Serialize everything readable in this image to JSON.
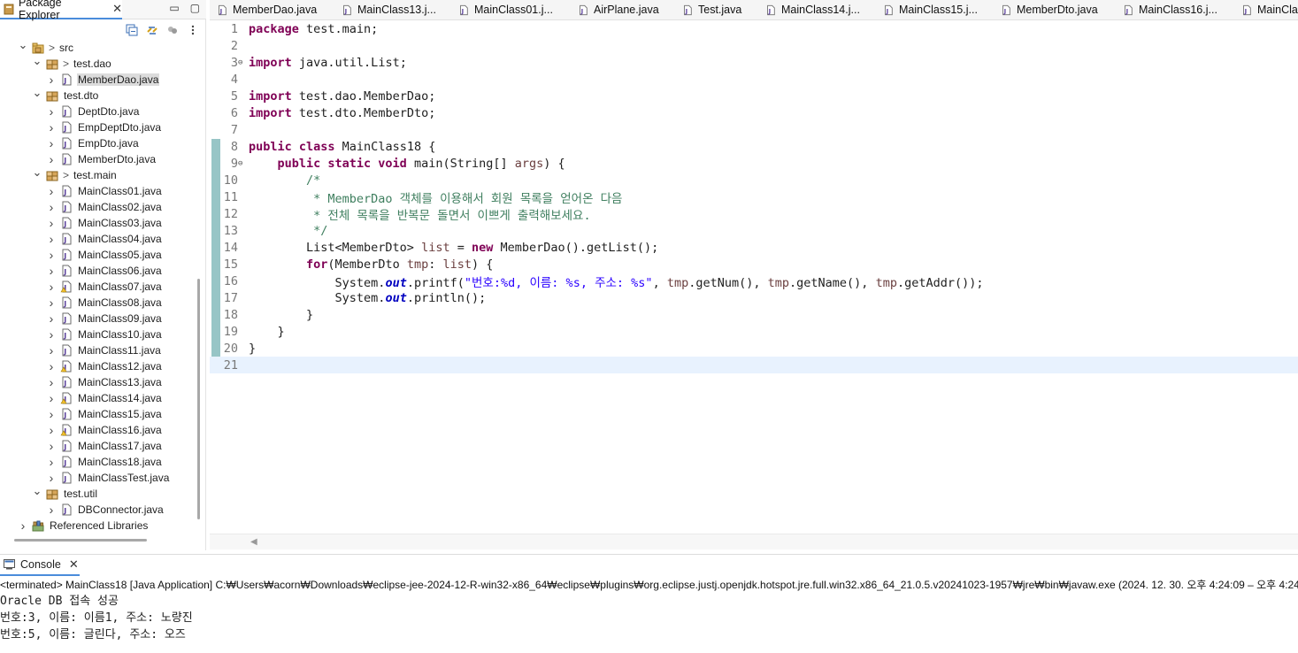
{
  "package_explorer": {
    "tab_label": "Package Explorer",
    "tree": [
      {
        "label": "src",
        "prefix": ">",
        "icon": "source-folder-icon",
        "twisty": "expanded",
        "indent": 0
      },
      {
        "label": "test.dao",
        "prefix": ">",
        "icon": "package-icon",
        "twisty": "expanded",
        "indent": 1
      },
      {
        "label": "MemberDao.java",
        "prefix": "",
        "icon": "java-file-icon",
        "twisty": "collapsed",
        "indent": 2,
        "selected": true
      },
      {
        "label": "test.dto",
        "prefix": "",
        "icon": "package-icon",
        "twisty": "expanded",
        "indent": 1
      },
      {
        "label": "DeptDto.java",
        "prefix": "",
        "icon": "java-file-icon",
        "twisty": "collapsed",
        "indent": 2
      },
      {
        "label": "EmpDeptDto.java",
        "prefix": "",
        "icon": "java-file-icon",
        "twisty": "collapsed",
        "indent": 2
      },
      {
        "label": "EmpDto.java",
        "prefix": "",
        "icon": "java-file-icon",
        "twisty": "collapsed",
        "indent": 2
      },
      {
        "label": "MemberDto.java",
        "prefix": "",
        "icon": "java-file-icon",
        "twisty": "collapsed",
        "indent": 2
      },
      {
        "label": "test.main",
        "prefix": ">",
        "icon": "package-icon",
        "twisty": "expanded",
        "indent": 1
      },
      {
        "label": "MainClass01.java",
        "prefix": "",
        "icon": "java-file-icon",
        "twisty": "collapsed",
        "indent": 2
      },
      {
        "label": "MainClass02.java",
        "prefix": "",
        "icon": "java-file-icon",
        "twisty": "collapsed",
        "indent": 2
      },
      {
        "label": "MainClass03.java",
        "prefix": "",
        "icon": "java-file-icon",
        "twisty": "collapsed",
        "indent": 2
      },
      {
        "label": "MainClass04.java",
        "prefix": "",
        "icon": "java-file-icon",
        "twisty": "collapsed",
        "indent": 2
      },
      {
        "label": "MainClass05.java",
        "prefix": "",
        "icon": "java-file-icon",
        "twisty": "collapsed",
        "indent": 2
      },
      {
        "label": "MainClass06.java",
        "prefix": "",
        "icon": "java-file-icon",
        "twisty": "collapsed",
        "indent": 2
      },
      {
        "label": "MainClass07.java",
        "prefix": "",
        "icon": "java-file-warning-icon",
        "twisty": "collapsed",
        "indent": 2
      },
      {
        "label": "MainClass08.java",
        "prefix": "",
        "icon": "java-file-icon",
        "twisty": "collapsed",
        "indent": 2
      },
      {
        "label": "MainClass09.java",
        "prefix": "",
        "icon": "java-file-icon",
        "twisty": "collapsed",
        "indent": 2
      },
      {
        "label": "MainClass10.java",
        "prefix": "",
        "icon": "java-file-icon",
        "twisty": "collapsed",
        "indent": 2
      },
      {
        "label": "MainClass11.java",
        "prefix": "",
        "icon": "java-file-icon",
        "twisty": "collapsed",
        "indent": 2
      },
      {
        "label": "MainClass12.java",
        "prefix": "",
        "icon": "java-file-warning-icon",
        "twisty": "collapsed",
        "indent": 2
      },
      {
        "label": "MainClass13.java",
        "prefix": "",
        "icon": "java-file-icon",
        "twisty": "collapsed",
        "indent": 2
      },
      {
        "label": "MainClass14.java",
        "prefix": "",
        "icon": "java-file-warning-icon",
        "twisty": "collapsed",
        "indent": 2
      },
      {
        "label": "MainClass15.java",
        "prefix": "",
        "icon": "java-file-icon",
        "twisty": "collapsed",
        "indent": 2
      },
      {
        "label": "MainClass16.java",
        "prefix": "",
        "icon": "java-file-warning-icon",
        "twisty": "collapsed",
        "indent": 2
      },
      {
        "label": "MainClass17.java",
        "prefix": "",
        "icon": "java-file-icon",
        "twisty": "collapsed",
        "indent": 2
      },
      {
        "label": "MainClass18.java",
        "prefix": "",
        "icon": "java-file-icon",
        "twisty": "collapsed",
        "indent": 2
      },
      {
        "label": "MainClassTest.java",
        "prefix": "",
        "icon": "java-file-icon",
        "twisty": "collapsed",
        "indent": 2
      },
      {
        "label": "test.util",
        "prefix": "",
        "icon": "package-icon",
        "twisty": "expanded",
        "indent": 1
      },
      {
        "label": "DBConnector.java",
        "prefix": "",
        "icon": "java-file-icon",
        "twisty": "collapsed",
        "indent": 2
      },
      {
        "label": "Referenced Libraries",
        "prefix": "",
        "icon": "library-icon",
        "twisty": "collapsed",
        "indent": 0
      }
    ]
  },
  "editor": {
    "tabs": [
      {
        "label": "MemberDao.java",
        "icon": "java-file-icon"
      },
      {
        "label": "MainClass13.j...",
        "icon": "java-file-icon"
      },
      {
        "label": "MainClass01.j...",
        "icon": "java-file-icon"
      },
      {
        "label": "AirPlane.java",
        "icon": "java-file-icon"
      },
      {
        "label": "Test.java",
        "icon": "java-file-icon"
      },
      {
        "label": "MainClass14.j...",
        "icon": "java-file-icon"
      },
      {
        "label": "MainClass15.j...",
        "icon": "java-file-icon"
      },
      {
        "label": "MemberDto.java",
        "icon": "java-file-icon"
      },
      {
        "label": "MainClass16.j...",
        "icon": "java-file-icon"
      },
      {
        "label": "MainClas",
        "icon": "java-file-icon"
      }
    ],
    "lines": [
      {
        "no": "1",
        "fold": "",
        "tokens": [
          [
            "kw",
            "package"
          ],
          [
            "p",
            " test.main;"
          ]
        ]
      },
      {
        "no": "2",
        "fold": "",
        "tokens": []
      },
      {
        "no": "3",
        "fold": "⊖",
        "tokens": [
          [
            "kw",
            "import"
          ],
          [
            "p",
            " java.util.List;"
          ]
        ]
      },
      {
        "no": "4",
        "fold": "",
        "tokens": []
      },
      {
        "no": "5",
        "fold": "",
        "tokens": [
          [
            "kw",
            "import"
          ],
          [
            "p",
            " test.dao.MemberDao;"
          ]
        ]
      },
      {
        "no": "6",
        "fold": "",
        "tokens": [
          [
            "kw",
            "import"
          ],
          [
            "p",
            " test.dto.MemberDto;"
          ]
        ]
      },
      {
        "no": "7",
        "fold": "",
        "tokens": []
      },
      {
        "no": "8",
        "fold": "",
        "tokens": [
          [
            "kw",
            "public class"
          ],
          [
            "p",
            " MainClass18 {"
          ]
        ]
      },
      {
        "no": "9",
        "fold": "⊖",
        "tokens": [
          [
            "p",
            "    "
          ],
          [
            "kw",
            "public static void"
          ],
          [
            "p",
            " main(String[] "
          ],
          [
            "var",
            "args"
          ],
          [
            "p",
            ") {"
          ]
        ]
      },
      {
        "no": "10",
        "fold": "",
        "tokens": [
          [
            "cm",
            "        /*"
          ]
        ]
      },
      {
        "no": "11",
        "fold": "",
        "tokens": [
          [
            "cm",
            "         * MemberDao 객체를 이용해서 회원 목록을 얻어온 다음"
          ]
        ]
      },
      {
        "no": "12",
        "fold": "",
        "tokens": [
          [
            "cm",
            "         * 전체 목록을 반복문 돌면서 이쁘게 출력해보세요."
          ]
        ]
      },
      {
        "no": "13",
        "fold": "",
        "tokens": [
          [
            "cm",
            "         */"
          ]
        ]
      },
      {
        "no": "14",
        "fold": "",
        "tokens": [
          [
            "p",
            "        List<MemberDto> "
          ],
          [
            "var",
            "list"
          ],
          [
            "p",
            " = "
          ],
          [
            "kw",
            "new"
          ],
          [
            "p",
            " MemberDao().getList();"
          ]
        ]
      },
      {
        "no": "15",
        "fold": "",
        "tokens": [
          [
            "p",
            "        "
          ],
          [
            "kw",
            "for"
          ],
          [
            "p",
            "(MemberDto "
          ],
          [
            "var",
            "tmp"
          ],
          [
            "p",
            ": "
          ],
          [
            "var",
            "list"
          ],
          [
            "p",
            ") {"
          ]
        ]
      },
      {
        "no": "16",
        "fold": "",
        "tokens": [
          [
            "p",
            "            System."
          ],
          [
            "fld",
            "out"
          ],
          [
            "p",
            ".printf("
          ],
          [
            "st",
            "\"번호:%d, 이름: %s, 주소: %s\""
          ],
          [
            "p",
            ", "
          ],
          [
            "var",
            "tmp"
          ],
          [
            "p",
            ".getNum(), "
          ],
          [
            "var",
            "tmp"
          ],
          [
            "p",
            ".getName(), "
          ],
          [
            "var",
            "tmp"
          ],
          [
            "p",
            ".getAddr());"
          ]
        ]
      },
      {
        "no": "17",
        "fold": "",
        "tokens": [
          [
            "p",
            "            System."
          ],
          [
            "fld",
            "out"
          ],
          [
            "p",
            ".println();"
          ]
        ]
      },
      {
        "no": "18",
        "fold": "",
        "tokens": [
          [
            "p",
            "        }"
          ]
        ]
      },
      {
        "no": "19",
        "fold": "",
        "tokens": [
          [
            "p",
            "    }"
          ]
        ]
      },
      {
        "no": "20",
        "fold": "",
        "tokens": [
          [
            "p",
            "}"
          ]
        ]
      },
      {
        "no": "21",
        "fold": "",
        "tokens": [],
        "current": true
      }
    ]
  },
  "console": {
    "tab_label": "Console",
    "header": "<terminated> MainClass18 [Java Application] C:₩Users₩acorn₩Downloads₩eclipse-jee-2024-12-R-win32-x86_64₩eclipse₩plugins₩org.eclipse.justj.openjdk.hotspot.jre.full.win32.x86_64_21.0.5.v20241023-1957₩jre₩bin₩javaw.exe  (2024. 12. 30. 오후 4:24:09 – 오후 4:24",
    "output": [
      "Oracle DB 접속 성공",
      "번호:3, 이름: 이름1, 주소: 노량진",
      "번호:5, 이름: 글린다, 주소: 오즈"
    ]
  },
  "colors": {
    "keyword": "#7f0055",
    "comment": "#3f7f5f",
    "string": "#2a00ff",
    "field": "#0000c0",
    "local_var": "#6a3e3e",
    "active_tab_underline": "#4a8cdb",
    "current_line": "#e8f2fe"
  }
}
